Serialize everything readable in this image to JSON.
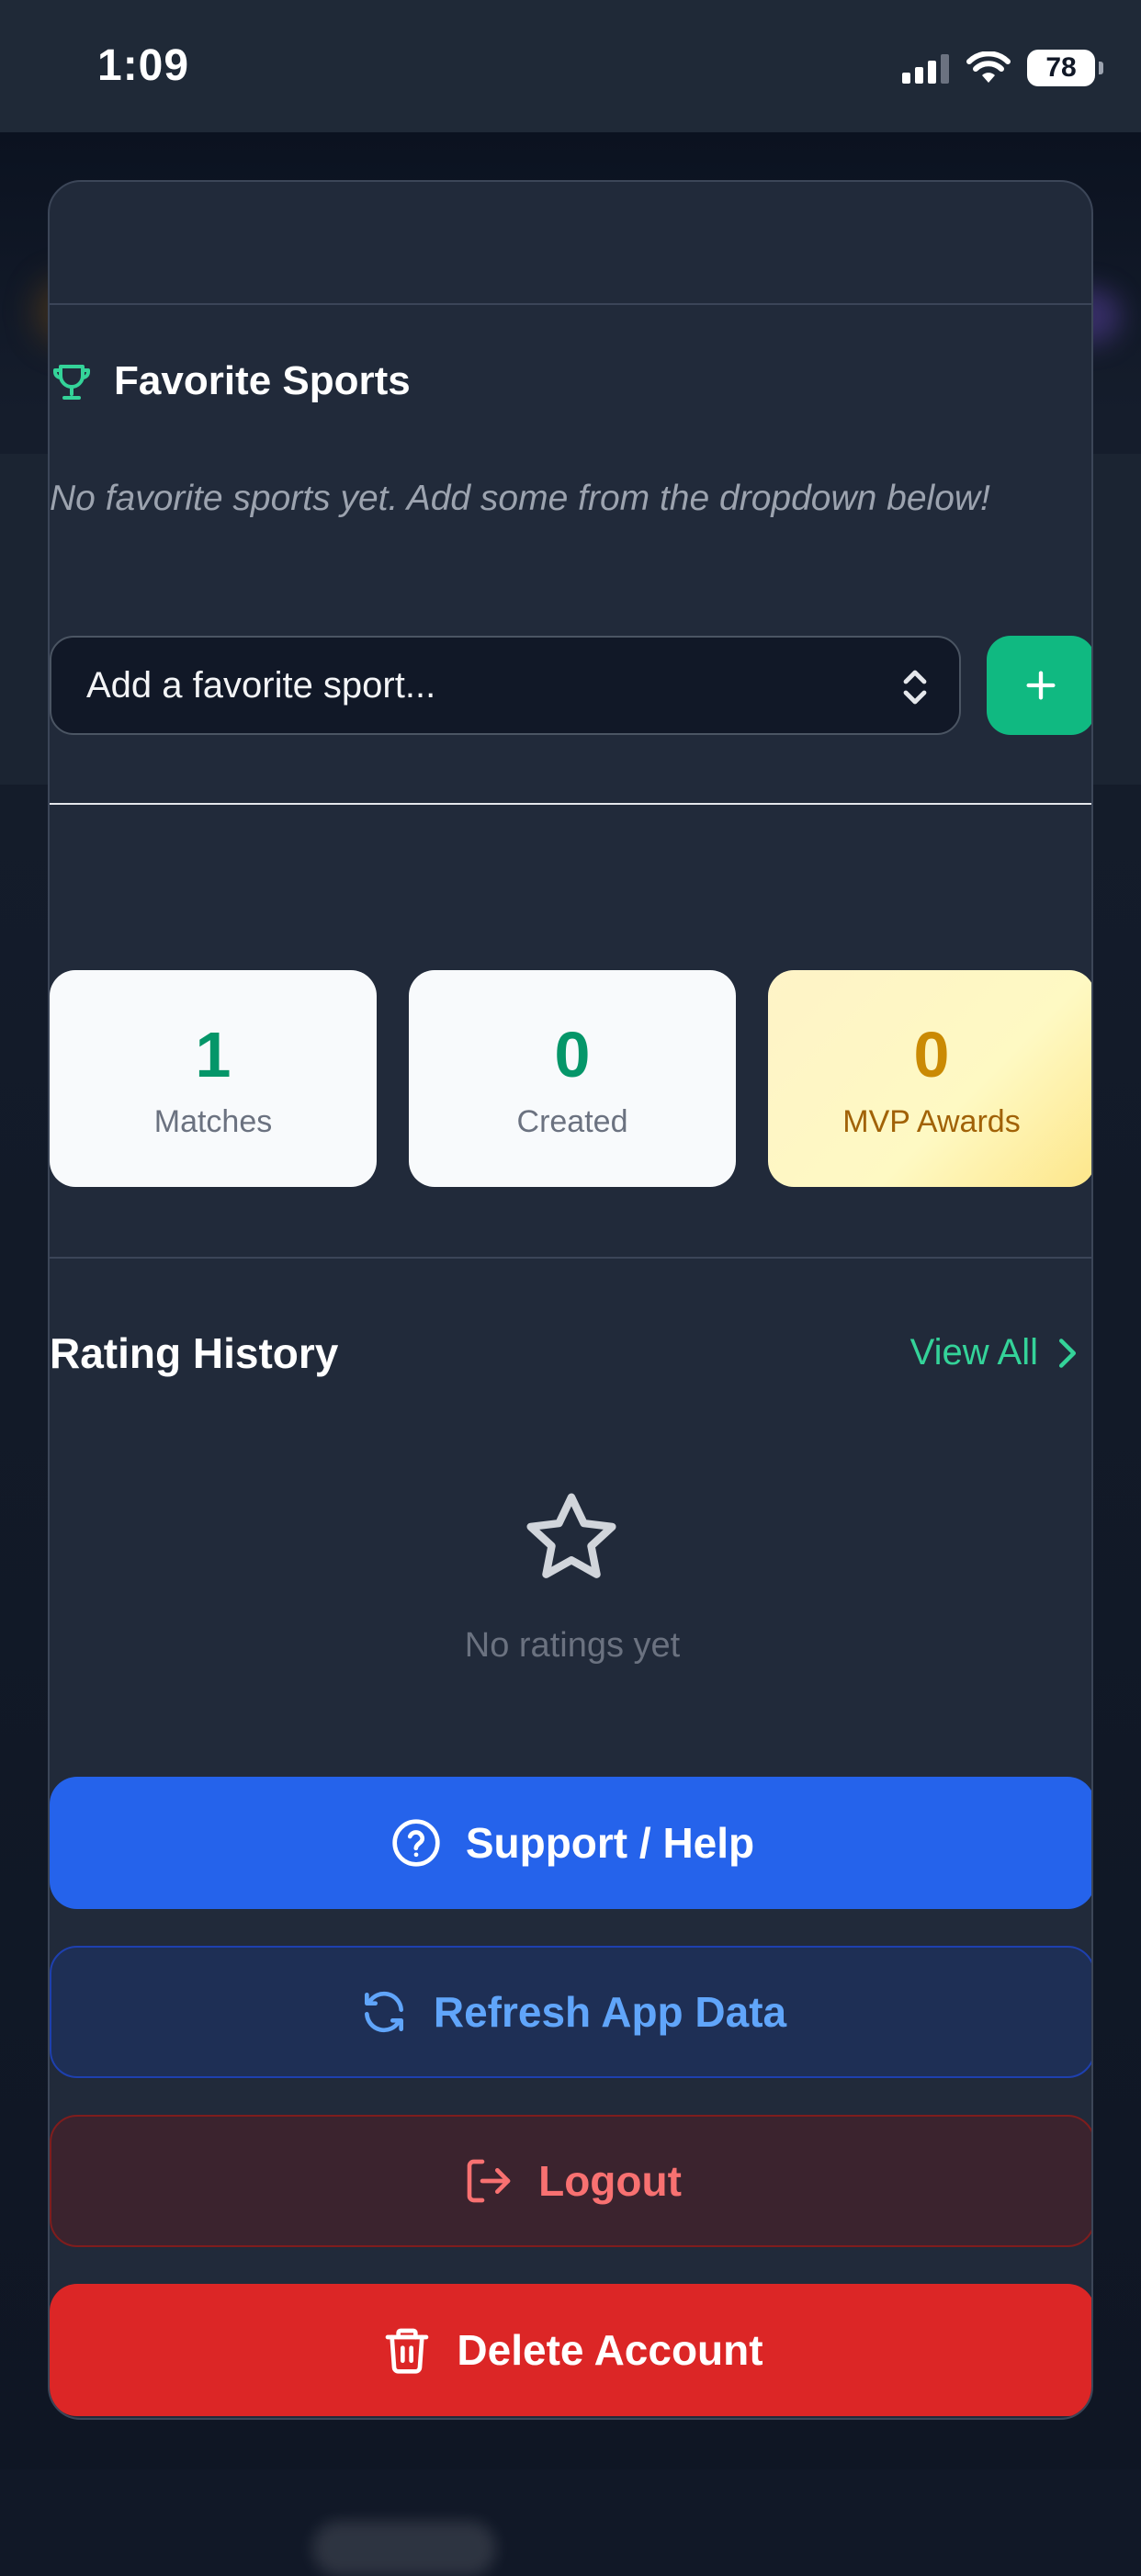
{
  "status_bar": {
    "time": "1:09",
    "battery": "78"
  },
  "favorite_sports": {
    "title": "Favorite Sports",
    "empty_message": "No favorite sports yet. Add some from the dropdown below!",
    "select_placeholder": "Add a favorite sport..."
  },
  "stats": [
    {
      "value": "1",
      "label": "Matches"
    },
    {
      "value": "0",
      "label": "Created"
    },
    {
      "value": "0",
      "label": "MVP Awards"
    }
  ],
  "rating_history": {
    "title": "Rating History",
    "view_all": "View All",
    "empty_message": "No ratings yet"
  },
  "actions": {
    "support": "Support / Help",
    "refresh": "Refresh App Data",
    "logout": "Logout",
    "delete": "Delete Account"
  },
  "colors": {
    "accent_green": "#10b981",
    "primary_blue": "#2563eb",
    "danger_red": "#dc2626",
    "mvp_gold": "#ca8a04"
  },
  "icons": [
    "trophy-icon",
    "chevron-updown-icon",
    "plus-icon",
    "chevron-right-icon",
    "star-icon",
    "help-circle-icon",
    "refresh-icon",
    "logout-icon",
    "trash-icon"
  ]
}
